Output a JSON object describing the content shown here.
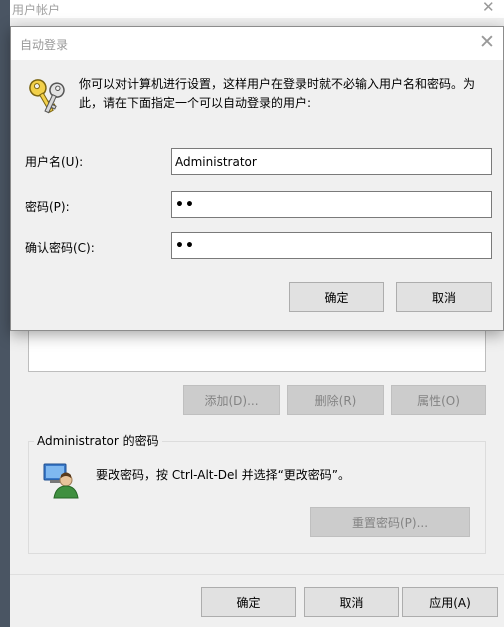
{
  "background_window": {
    "title": "用户帐户",
    "close_glyph": "✕",
    "list_buttons": {
      "add": "添加(D)...",
      "remove": "删除(R)",
      "properties": "属性(O)"
    },
    "password_group": {
      "title": "Administrator 的密码",
      "info": "要改密码，按 Ctrl-Alt-Del 并选择“更改密码”。",
      "reset_button": "重置密码(P)..."
    },
    "footer": {
      "ok": "确定",
      "cancel": "取消",
      "apply": "应用(A)"
    }
  },
  "dialog": {
    "title": "自动登录",
    "close_glyph": "✕",
    "description": "你可以对计算机进行设置，这样用户在登录时就不必输入用户名和密码。为此，请在下面指定一个可以自动登录的用户:",
    "icon": "keys-icon",
    "fields": {
      "username_label": "用户名(U):",
      "username_value": "Administrator",
      "password_label": "密码(P):",
      "password_value": "••",
      "confirm_label": "确认密码(C):",
      "confirm_value": "••"
    },
    "ok_button": "确定",
    "cancel_button": "取消"
  },
  "colors": {
    "window_bg": "#f0f0f0",
    "title_text": "#999999",
    "disabled_button_text": "#838383"
  }
}
